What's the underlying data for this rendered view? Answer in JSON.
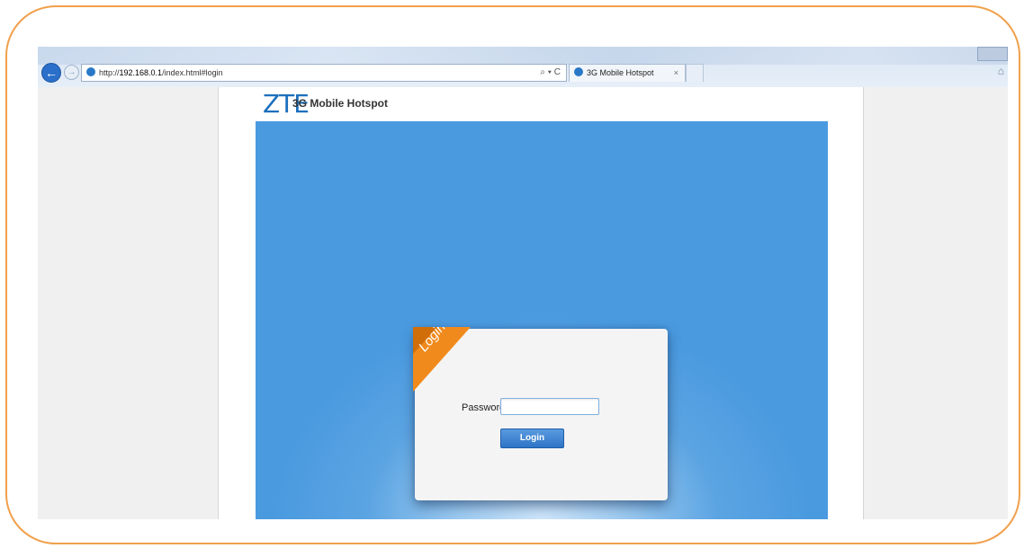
{
  "browser": {
    "address_prefix": "http://",
    "address_host": "192.168.0.1",
    "address_path": "/index.html#login",
    "address_controls": "⌕ ▾ C",
    "tab_title": "3G Mobile Hotspot",
    "tab_close": "×"
  },
  "page": {
    "logo": "ZTE",
    "product_name": "3G Mobile Hotspot"
  },
  "login": {
    "ribbon_label": "Login",
    "password_label": "Password",
    "password_value": "",
    "submit_label": "Login"
  },
  "colors": {
    "frame_border": "#f0a04b",
    "brand_blue": "#1c6fbd",
    "banner_blue": "#4a9ae0",
    "ribbon_orange": "#f08a1c",
    "button_blue": "#2e74c6"
  }
}
